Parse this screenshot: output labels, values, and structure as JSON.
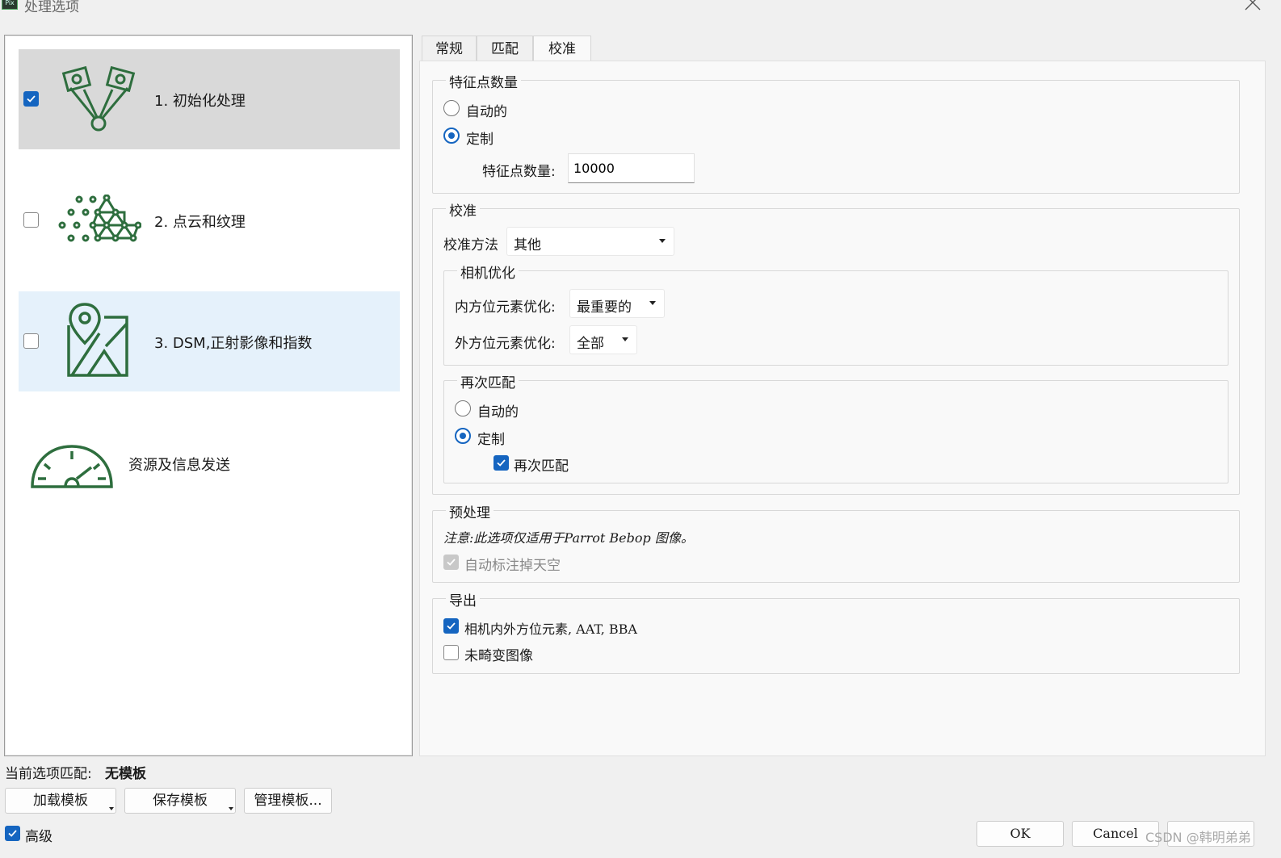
{
  "window": {
    "title": "处理选项",
    "app_icon": "Pix4D"
  },
  "steps": [
    {
      "label": "1. 初始化处理",
      "checked": true,
      "icon": "tie-points-icon"
    },
    {
      "label": "2. 点云和纹理",
      "checked": false,
      "icon": "point-cloud-icon"
    },
    {
      "label": "3. DSM,正射影像和指数",
      "checked": false,
      "icon": "map-pin-icon"
    }
  ],
  "resources": {
    "label": "资源及信息发送",
    "icon": "speedometer-icon"
  },
  "tabs": [
    "常规",
    "匹配",
    "校准"
  ],
  "active_tab": "校准",
  "keypoints": {
    "title": "特征点数量",
    "auto_label": "自动的",
    "custom_label": "定制",
    "count_label": "特征点数量:",
    "count_value": "10000"
  },
  "calibration": {
    "title": "校准",
    "method_label": "校准方法",
    "method_value": "其他",
    "camera_opt": {
      "title": "相机优化",
      "internal_label": "内方位元素优化:",
      "internal_value": "最重要的",
      "external_label": "外方位元素优化:",
      "external_value": "全部"
    },
    "rematch": {
      "title": "再次匹配",
      "auto_label": "自动的",
      "custom_label": "定制",
      "rematch_label": "再次匹配"
    }
  },
  "preprocessing": {
    "title": "预处理",
    "note": "注意:此选项仅适用于Parrot Bebop 图像。",
    "sky_label": "自动标注掉天空"
  },
  "export": {
    "title": "导出",
    "camera_params_label": "相机内外方位元素, AAT, BBA",
    "undistorted_label": "未畸变图像"
  },
  "template": {
    "current_label": "当前选项匹配:",
    "current_value": "无模板",
    "load_label": "加载模板",
    "save_label": "保存模板",
    "manage_label": "管理模板..."
  },
  "advanced_label": "高级",
  "ok_label": "OK",
  "cancel_label": "Cancel",
  "watermark": "CSDN @韩明弟弟",
  "colors": {
    "accent": "#1565c0",
    "icon_green": "#2e6e3e",
    "selected_bg": "#d9d9d9",
    "hover_bg": "#e5f1fb"
  }
}
